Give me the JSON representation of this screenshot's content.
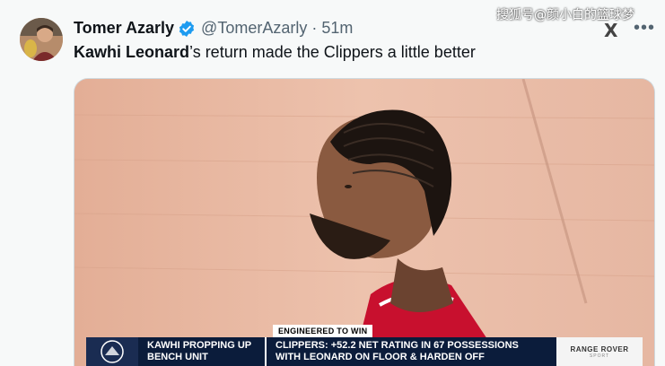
{
  "author": {
    "name": "Tomer Azarly",
    "handle": "@TomerAzarly",
    "separator": "·",
    "time": "51m",
    "verified": true
  },
  "tweet": {
    "bold_text": "Kawhi Leonard",
    "text": "’s return made the Clippers a little better"
  },
  "watermark": "搜狐号@颜小白的篮球梦",
  "icons": {
    "x_logo": "X",
    "more": "•••"
  },
  "media": {
    "engineered_tag": "ENGINEERED TO WIN",
    "lower_third_left": "KAWHI PROPPING UP\nBENCH UNIT",
    "lower_third_right": "CLIPPERS: +52.2 NET RATING IN 67 POSSESSIONS\nWITH LEONARD ON FLOOR & HARDEN OFF",
    "sponsor": "RANGE ROVER",
    "sponsor_sub": "SPORT"
  },
  "colors": {
    "verified_blue": "#1d9bf0",
    "jersey_red": "#c8102e",
    "court": "#e8b8a2"
  }
}
